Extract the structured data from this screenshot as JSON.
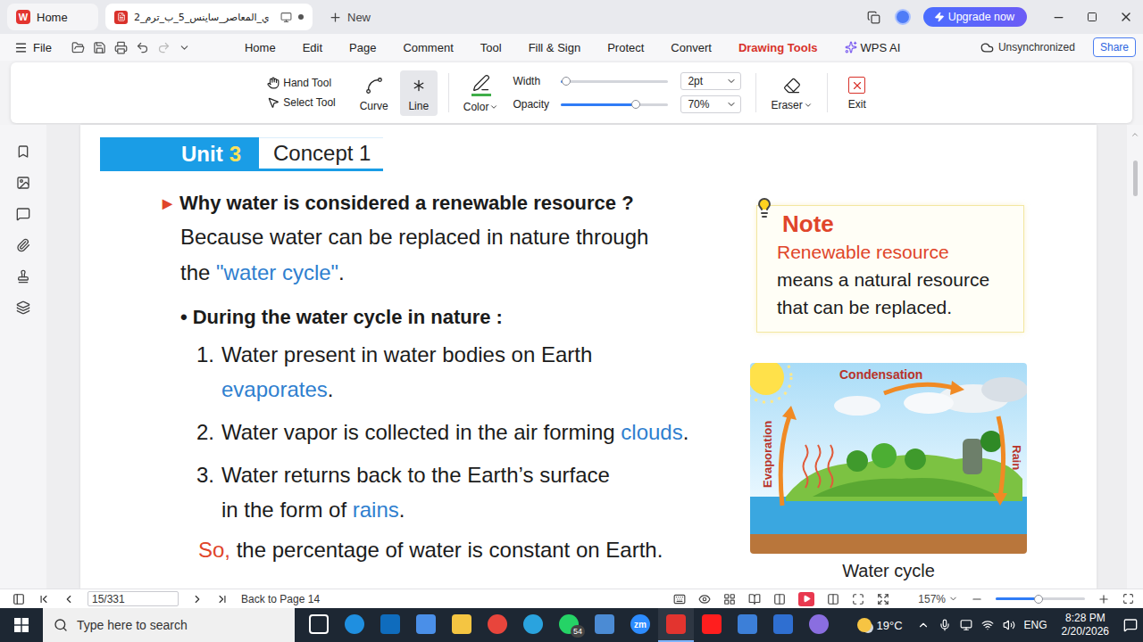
{
  "title_bar": {
    "logo": "W",
    "tabs": [
      {
        "label": "Home",
        "kind": "home",
        "selected": false
      },
      {
        "label": "ي_المعاصر_ساينس_5_ب_ترم_2",
        "kind": "document",
        "selected": true
      }
    ],
    "new_tab": "New",
    "upgrade": "Upgrade now"
  },
  "menu": {
    "file": "File",
    "items": [
      {
        "label": "Home",
        "kind": "text",
        "selected": false
      },
      {
        "label": "Edit",
        "kind": "text",
        "selected": false
      },
      {
        "label": "Page",
        "kind": "text",
        "selected": false
      },
      {
        "label": "Comment",
        "kind": "text",
        "selected": false
      },
      {
        "label": "Tool",
        "kind": "text",
        "selected": false
      },
      {
        "label": "Fill & Sign",
        "kind": "text",
        "selected": false
      },
      {
        "label": "Protect",
        "kind": "text",
        "selected": false
      },
      {
        "label": "Convert",
        "kind": "text",
        "selected": false
      },
      {
        "label": "Drawing Tools",
        "kind": "text",
        "selected": true
      },
      {
        "label": "WPS AI",
        "kind": "ai",
        "selected": false
      }
    ],
    "sync": "Unsynchronized",
    "share": "Share"
  },
  "ribbon": {
    "tools": [
      "Hand Tool",
      "Select Tool"
    ],
    "shapes": [
      {
        "label": "Curve",
        "selected": false
      },
      {
        "label": "Line",
        "selected": true
      }
    ],
    "color": "Color",
    "sliders": [
      {
        "label": "Width",
        "level": 0.05,
        "value": "2pt"
      },
      {
        "label": "Opacity",
        "level": 0.7,
        "value": "70%"
      }
    ],
    "eraser": "Eraser",
    "exit": "Exit"
  },
  "document": {
    "unit": "Unit",
    "unit_number": "3",
    "concept": "Concept 1",
    "question": {
      "marker": "▶",
      "text": "Why water is considered a renewable resource ?"
    },
    "answer": [
      [
        {
          "text": "Because water can be replaced in nature through",
          "kind": "plain"
        }
      ],
      [
        {
          "text": "the ",
          "kind": "plain"
        },
        {
          "text": "\"water cycle\"",
          "kind": "term"
        },
        {
          "text": ".",
          "kind": "plain"
        }
      ]
    ],
    "bullet": {
      "marker": "•",
      "text": "During the water cycle in nature :"
    },
    "steps": [
      {
        "number": "1.",
        "lines": [
          [
            {
              "text": "Water present in water bodies on Earth",
              "kind": "plain"
            }
          ],
          [
            {
              "text": "evaporates",
              "kind": "term"
            },
            {
              "text": ".",
              "kind": "plain"
            }
          ]
        ]
      },
      {
        "number": "2.",
        "lines": [
          [
            {
              "text": "Water vapor is collected in the air forming ",
              "kind": "plain"
            },
            {
              "text": "clouds",
              "kind": "term"
            },
            {
              "text": ".",
              "kind": "plain"
            }
          ]
        ]
      },
      {
        "number": "3.",
        "lines": [
          [
            {
              "text": "Water returns back to the Earth’s surface",
              "kind": "plain"
            }
          ],
          [
            {
              "text": "in the form of ",
              "kind": "plain"
            },
            {
              "text": "rains",
              "kind": "term"
            },
            {
              "text": ".",
              "kind": "plain"
            }
          ]
        ]
      }
    ],
    "conclusion": [
      {
        "text": "So,",
        "kind": "lead"
      },
      {
        "text": " the percentage of water is constant on Earth.",
        "kind": "plain"
      }
    ],
    "note": {
      "title": "Note",
      "lines": [
        [
          {
            "text": "Renewable resource",
            "kind": "lead"
          }
        ],
        [
          {
            "text": "means a natural resource",
            "kind": "plain"
          }
        ],
        [
          {
            "text": "that can be replaced.",
            "kind": "plain"
          }
        ]
      ]
    },
    "figure": {
      "top": "Condensation",
      "left": "Evaporation",
      "right": "Rain",
      "caption": "Water cycle"
    }
  },
  "status_bar": {
    "page": "15/331",
    "back": "Back to Page 14",
    "zoom": "157%",
    "zoom_level": 0.48
  },
  "taskbar": {
    "search": "Type here to search",
    "apps": [
      {
        "kind": "outline",
        "color": "#ffffff",
        "selected": false
      },
      {
        "kind": "circle",
        "color": "#1f8fe0",
        "selected": false
      },
      {
        "kind": "square",
        "color": "#0f6cbd",
        "selected": false
      },
      {
        "kind": "square",
        "color": "#4a8fe8",
        "selected": false
      },
      {
        "kind": "square",
        "color": "#f4c542",
        "selected": false
      },
      {
        "kind": "circle",
        "color": "#e8453c",
        "selected": false
      },
      {
        "kind": "circle",
        "color": "#2aa3de",
        "selected": false
      },
      {
        "kind": "circle",
        "color": "#25d366",
        "selected": false,
        "badge": "54"
      },
      {
        "kind": "square",
        "color": "#4b8bd4",
        "selected": false
      },
      {
        "kind": "circle",
        "color": "#2d8cff",
        "selected": false,
        "label": "zm"
      },
      {
        "kind": "square",
        "color": "#e3342f",
        "selected": true
      },
      {
        "kind": "square",
        "color": "#ff1e1e",
        "selected": false
      },
      {
        "kind": "square",
        "color": "#3c7fd8",
        "selected": false
      },
      {
        "kind": "square",
        "color": "#2f6fd1",
        "selected": false
      },
      {
        "kind": "circle",
        "color": "#8a6ee0",
        "selected": false
      }
    ],
    "weather": "19°C",
    "language": "ENG",
    "time": "8:28 PM",
    "date": "2/20/2026"
  }
}
